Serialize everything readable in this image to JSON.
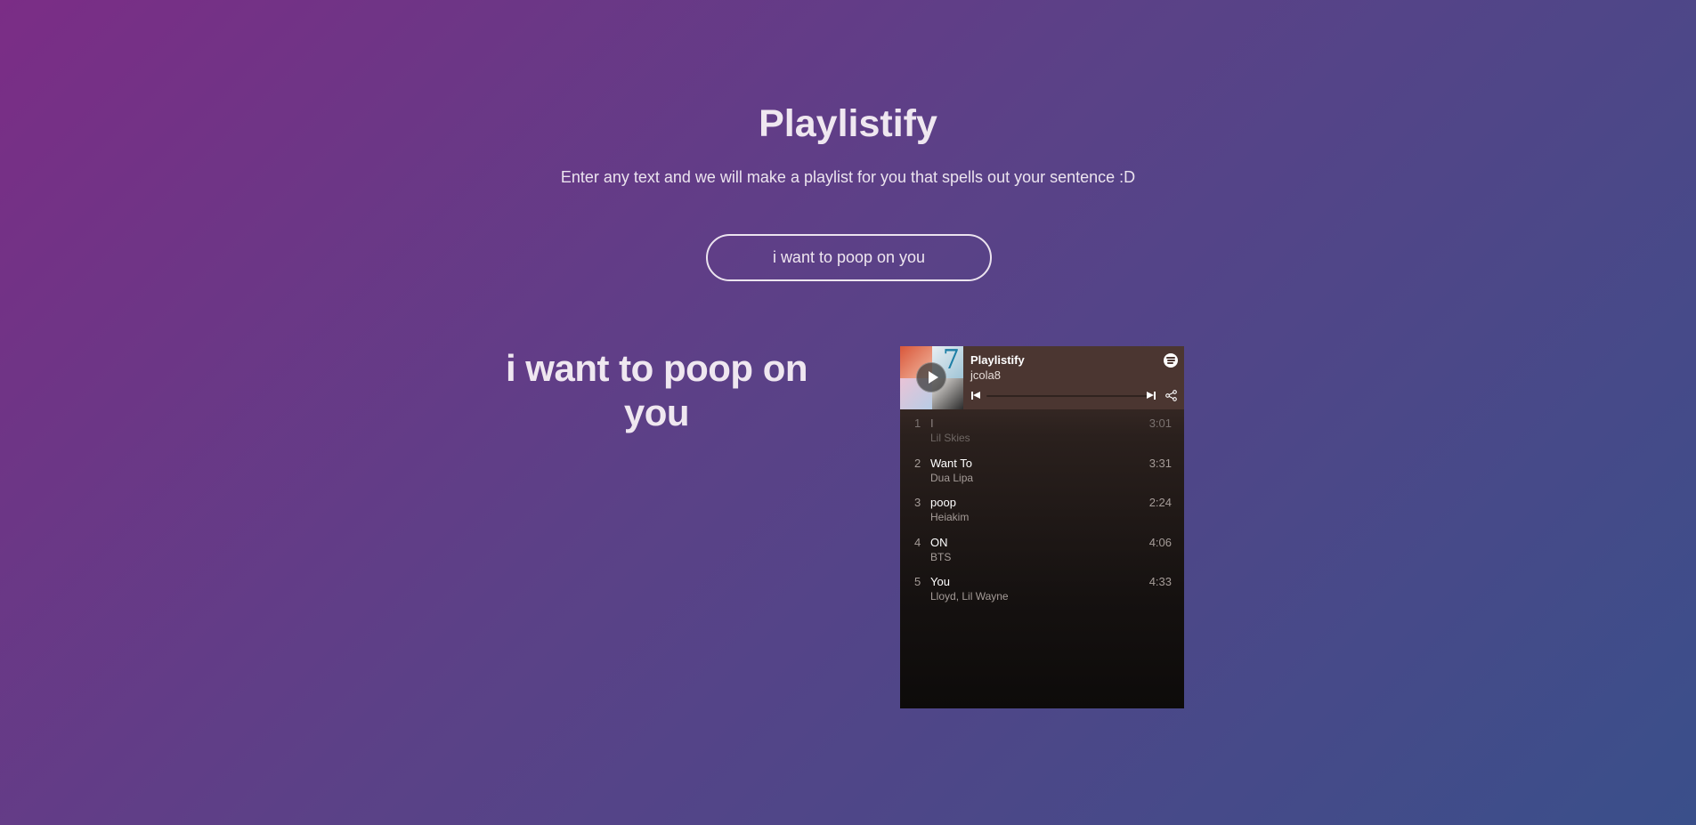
{
  "header": {
    "title": "Playlistify",
    "subtitle": "Enter any text and we will make a playlist for you that spells out your sentence :D"
  },
  "input": {
    "value": "i want to poop on you"
  },
  "result": {
    "sentence": "i want to poop on you"
  },
  "player": {
    "playlist_title": "Playlistify",
    "owner": "jcola8",
    "icons": {
      "play": "play-icon",
      "brand": "spotify-icon",
      "prev": "previous-track-icon",
      "next": "next-track-icon",
      "share": "share-icon"
    },
    "tracks": [
      {
        "num": "1",
        "name": "I",
        "artist": "Lil Skies",
        "duration": "3:01"
      },
      {
        "num": "2",
        "name": "Want To",
        "artist": "Dua Lipa",
        "duration": "3:31"
      },
      {
        "num": "3",
        "name": "poop",
        "artist": "Heiakim",
        "duration": "2:24"
      },
      {
        "num": "4",
        "name": "ON",
        "artist": "BTS",
        "duration": "4:06"
      },
      {
        "num": "5",
        "name": "You",
        "artist": "Lloyd, Lil Wayne",
        "duration": "4:33"
      }
    ]
  },
  "colors": {
    "gradient_start": "#7b2d86",
    "gradient_end": "#3a4f8a",
    "player_header": "#4b3631",
    "text": "#ece4ef"
  }
}
